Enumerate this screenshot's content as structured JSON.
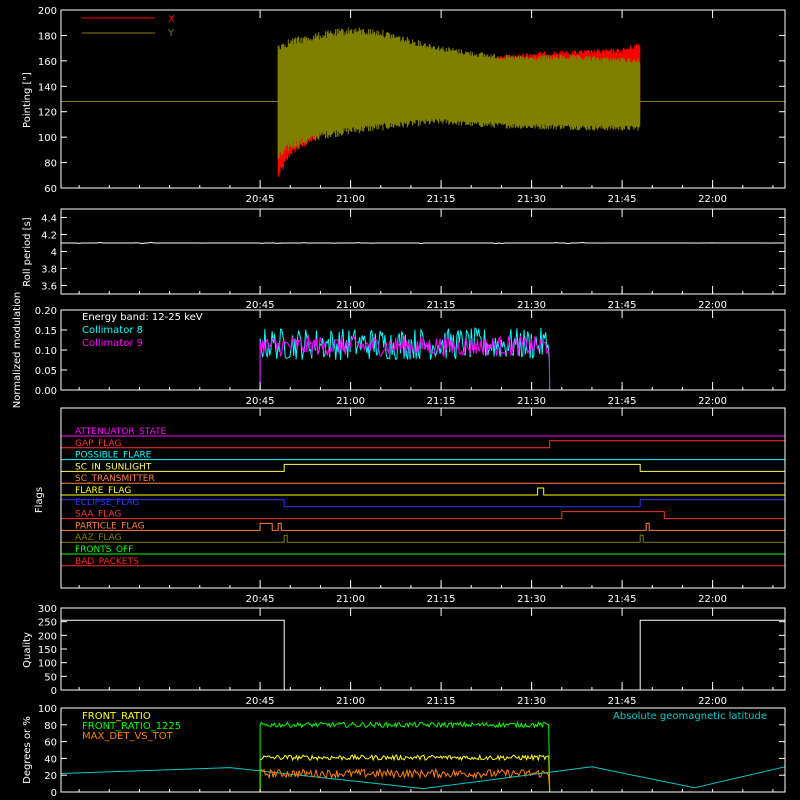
{
  "chart_data": [
    {
      "type": "line",
      "id": "pointing",
      "ylabel": "Pointing [\"]",
      "ylim": [
        60,
        200
      ],
      "yticks": [
        60,
        80,
        100,
        120,
        140,
        160,
        180,
        200
      ],
      "xticks": [
        "20:45",
        "21:00",
        "21:15",
        "21:30",
        "21:45",
        "22:00"
      ],
      "legend": "top-left",
      "colors": {
        "X": "#ff0000",
        "Y": "#808000"
      },
      "series": [
        {
          "name": "X",
          "t_start": "20:48",
          "t_end": "21:48",
          "envelope_x": [
            "20:48",
            "20:50",
            "20:55",
            "21:00",
            "21:05",
            "21:10",
            "21:15",
            "21:20",
            "21:25",
            "21:30",
            "21:35",
            "21:40",
            "21:45",
            "21:48"
          ],
          "upper": [
            170,
            150,
            148,
            146,
            148,
            152,
            156,
            160,
            164,
            167,
            168,
            169,
            170,
            175
          ],
          "lower": [
            65,
            85,
            100,
            110,
            118,
            120,
            122,
            120,
            118,
            116,
            116,
            115,
            115,
            115
          ]
        },
        {
          "name": "Y",
          "t_start": "20:48",
          "t_end": "21:48",
          "baseline": 128,
          "envelope_x": [
            "20:48",
            "20:50",
            "20:55",
            "21:00",
            "21:05",
            "21:10",
            "21:15",
            "21:20",
            "21:25",
            "21:30",
            "21:35",
            "21:40",
            "21:45",
            "21:48"
          ],
          "upper": [
            175,
            178,
            183,
            187,
            185,
            178,
            172,
            168,
            165,
            164,
            165,
            164,
            163,
            162
          ],
          "lower": [
            80,
            90,
            98,
            102,
            105,
            108,
            110,
            108,
            107,
            106,
            106,
            105,
            105,
            105
          ]
        }
      ]
    },
    {
      "type": "line",
      "id": "roll",
      "ylabel": "Roll period [s]",
      "ylim": [
        3.5,
        4.5
      ],
      "yticks": [
        3.6,
        3.8,
        4.0,
        4.2,
        4.4
      ],
      "xticks": [
        "20:45",
        "21:00",
        "21:15",
        "21:30",
        "21:45",
        "22:00"
      ],
      "series": [
        {
          "name": "",
          "value": 4.1
        }
      ]
    },
    {
      "type": "line",
      "id": "modulation",
      "ylabel": "Normalized modulation",
      "ylim": [
        0.0,
        0.2
      ],
      "yticks": [
        "0.00",
        "0.05",
        "0.10",
        "0.15",
        "0.20"
      ],
      "xticks": [
        "20:45",
        "21:00",
        "21:15",
        "21:30",
        "21:45",
        "22:00"
      ],
      "annotation": "Energy band: 12-25 keV",
      "colors": {
        "Collimator 8": "#00ffff",
        "Collimator 9": "#ff00ff"
      },
      "series": [
        {
          "name": "Collimator 8",
          "t_start": "20:45",
          "t_end": "21:33",
          "mean": 0.115,
          "spread": 0.04
        },
        {
          "name": "Collimator 9",
          "t_start": "20:45",
          "t_end": "21:33",
          "mean": 0.11,
          "spread": 0.025
        }
      ]
    },
    {
      "type": "line",
      "id": "flags",
      "ylabel": "Flags",
      "xticks": [
        "20:45",
        "21:00",
        "21:15",
        "21:30",
        "21:45",
        "22:00"
      ],
      "series": [
        {
          "name": "ATTENUATOR_STATE",
          "color": "#ff00ff",
          "segments": []
        },
        {
          "name": "GAP_FLAG",
          "color": "#ff3030",
          "segments": [
            [
              "21:33",
              "22:12"
            ]
          ]
        },
        {
          "name": "POSSIBLE_FLARE",
          "color": "#00ffff",
          "segments": []
        },
        {
          "name": "SC_IN_SUNLIGHT",
          "color": "#ffff60",
          "segments": [
            [
              "20:49",
              "21:48"
            ]
          ]
        },
        {
          "name": "SC_TRANSMITTER",
          "color": "#ff8040",
          "segments": []
        },
        {
          "name": "FLARE_FLAG",
          "color": "#ffff00",
          "segments": [
            [
              "21:31",
              "21:32"
            ]
          ]
        },
        {
          "name": "ECLIPSE_FLAG",
          "color": "#3030ff",
          "segments": [
            [
              "20:12",
              "20:49"
            ],
            [
              "21:48",
              "22:12"
            ]
          ]
        },
        {
          "name": "SAA_FLAG",
          "color": "#ff3030",
          "segments": [
            [
              "21:35",
              "21:52"
            ]
          ]
        },
        {
          "name": "PARTICLE_FLAG",
          "color": "#ff8040",
          "segments": [
            [
              "20:45",
              "20:47"
            ],
            [
              "20:48",
              "20:48"
            ],
            [
              "21:49",
              "21:49"
            ]
          ]
        },
        {
          "name": "AAZ_FLAG",
          "color": "#808000",
          "segments": [
            [
              "20:49",
              "20:49"
            ],
            [
              "21:48",
              "21:48"
            ]
          ]
        },
        {
          "name": "FRONTS_OFF",
          "color": "#00ff00",
          "segments": []
        },
        {
          "name": "BAD_PACKETS",
          "color": "#ff2020",
          "segments": []
        }
      ]
    },
    {
      "type": "line",
      "id": "quality",
      "ylabel": "Quality",
      "ylim": [
        0,
        300
      ],
      "yticks": [
        0,
        50,
        100,
        150,
        200,
        250,
        300
      ],
      "xticks": [
        "20:45",
        "21:00",
        "21:15",
        "21:30",
        "21:45",
        "22:00"
      ],
      "series": [
        {
          "name": "",
          "points": [
            [
              "20:12",
              255
            ],
            [
              "20:49",
              255
            ],
            [
              "20:49",
              0
            ],
            [
              "21:48",
              0
            ],
            [
              "21:48",
              255
            ],
            [
              "22:12",
              255
            ]
          ]
        }
      ]
    },
    {
      "type": "line",
      "id": "ratios",
      "ylabel": "Degrees or %",
      "ylim": [
        0,
        100
      ],
      "yticks": [
        0,
        20,
        40,
        60,
        80,
        100
      ],
      "xticks": [],
      "legend": "top-left",
      "colors": {
        "FRONT_RATIO": "#ffff00",
        "FRONT_RATIO_1225": "#00ff00",
        "MAX_DET_VS_TOT": "#ff8000",
        "Absolute geomagnetic latitude": "#00cccc"
      },
      "series": [
        {
          "name": "FRONT_RATIO",
          "t_start": "20:45",
          "t_end": "21:33",
          "mean": 41,
          "spread": 3
        },
        {
          "name": "FRONT_RATIO_1225",
          "t_start": "20:45",
          "t_end": "21:33",
          "mean": 80,
          "spread": 3
        },
        {
          "name": "MAX_DET_VS_TOT",
          "t_start": "20:45",
          "t_end": "21:33",
          "mean": 22,
          "spread": 5
        },
        {
          "name": "Absolute geomagnetic latitude",
          "points": [
            [
              "20:12",
              22
            ],
            [
              "20:40",
              29
            ],
            [
              "21:12",
              4
            ],
            [
              "21:40",
              30
            ],
            [
              "21:57",
              5
            ],
            [
              "22:12",
              30
            ]
          ]
        }
      ]
    }
  ]
}
